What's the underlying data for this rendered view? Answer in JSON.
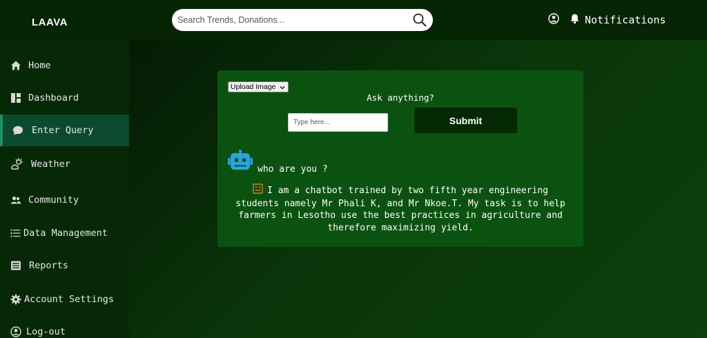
{
  "header": {
    "brand": "LAAVA",
    "search": {
      "placeholder": "Search Trends, Donations..."
    },
    "notifications_label": "Notifications"
  },
  "sidebar": {
    "items": [
      {
        "label": "Home",
        "icon": "home-icon"
      },
      {
        "label": "Dashboard",
        "icon": "dashboard-icon"
      },
      {
        "label": "Enter Query",
        "icon": "chat-icon",
        "active": true
      },
      {
        "label": "Weather",
        "icon": "weather-icon"
      },
      {
        "label": "Community",
        "icon": "community-icon"
      },
      {
        "label": "Data Management",
        "icon": "list-icon"
      },
      {
        "label": "Reports",
        "icon": "reports-icon"
      },
      {
        "label": "Account Settings",
        "icon": "gear-icon"
      },
      {
        "label": "Log-out",
        "icon": "logout-icon"
      }
    ]
  },
  "chat_card": {
    "upload_select": "Upload Image",
    "ask_label": "Ask anything?",
    "input_placeholder": "Type here...",
    "submit_label": "Submit",
    "user_message": "who are you ?",
    "bot_reply": "I am a chatbot trained by two fifth year engineering students namely Mr Phali K, and Mr Nkoe.T. My task is to help farmers in Lesotho use the best practices in agriculture and therefore maximizing yield."
  },
  "colors": {
    "header_bg": "#052505",
    "sidebar_bg": "#062806",
    "active_item_bg": "#0c4a30",
    "card_bg": "#0b5211",
    "submit_bg": "#042804",
    "bot_icon": "#29a3e0",
    "reply_icon": "#e07b1a"
  }
}
